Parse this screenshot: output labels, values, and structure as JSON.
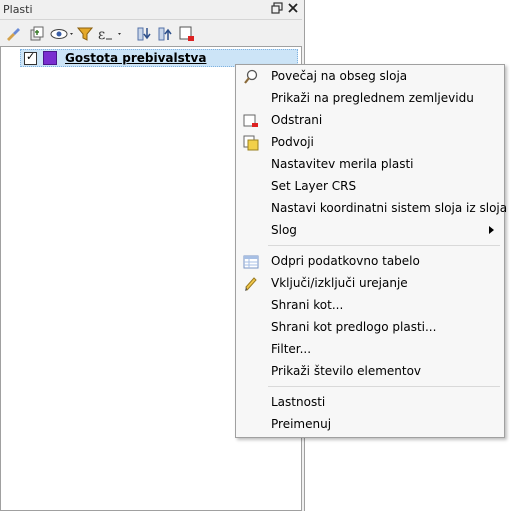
{
  "panel": {
    "title": "Plasti",
    "float_icon": "float-icon",
    "close_icon": "close-icon",
    "toolbar_icons": [
      "brush-icon",
      "add-group-icon",
      "eye-icon",
      "filter-icon",
      "expression-icon",
      "expand-all-icon",
      "collapse-all-icon",
      "remove-layer-icon"
    ]
  },
  "tree": {
    "layer": {
      "name": "Gostota prebivalstva",
      "checked": true,
      "color": "#7a2ed0"
    }
  },
  "menu": {
    "items": [
      {
        "label": "Povečaj na obseg sloja",
        "icon": "zoom-icon"
      },
      {
        "label": "Prikaži na preglednem zemljevidu",
        "icon": ""
      },
      {
        "label": "Odstrani",
        "icon": "remove-icon"
      },
      {
        "label": "Podvoji",
        "icon": "duplicate-icon"
      },
      {
        "label": "Nastavitev merila plasti",
        "icon": ""
      },
      {
        "label": "Set Layer CRS",
        "icon": ""
      },
      {
        "label": "Nastavi koordinatni sistem sloja iz sloja",
        "icon": ""
      },
      {
        "label": "Slog",
        "icon": "",
        "submenu": true
      },
      {
        "label": "Odpri podatkovno tabelo",
        "icon": "table-icon"
      },
      {
        "label": "Vključi/izključi urejanje",
        "icon": "pencil-icon"
      },
      {
        "label": "Shrani kot...",
        "icon": ""
      },
      {
        "label": "Shrani kot predlogo plasti...",
        "icon": ""
      },
      {
        "label": "Filter...",
        "icon": ""
      },
      {
        "label": "Prikaži število elementov",
        "icon": ""
      },
      {
        "label": "Lastnosti",
        "icon": ""
      },
      {
        "label": "Preimenuj",
        "icon": ""
      }
    ]
  }
}
